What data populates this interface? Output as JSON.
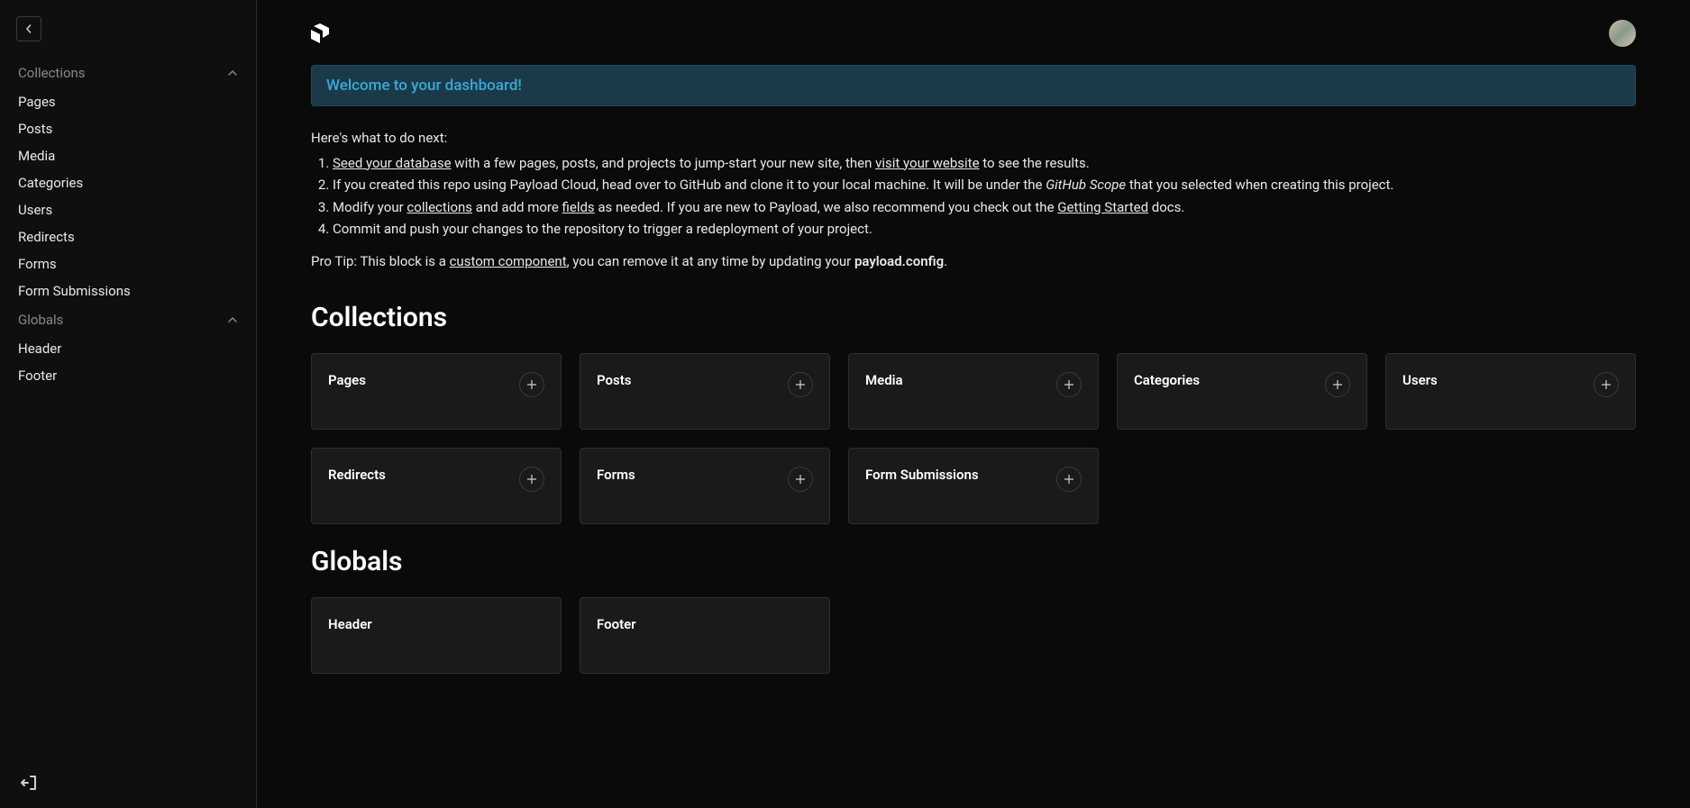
{
  "sidebar": {
    "groups": [
      {
        "label": "Collections",
        "items": [
          "Pages",
          "Posts",
          "Media",
          "Categories",
          "Users",
          "Redirects",
          "Forms",
          "Form Submissions"
        ]
      },
      {
        "label": "Globals",
        "items": [
          "Header",
          "Footer"
        ]
      }
    ]
  },
  "banner": "Welcome to your dashboard!",
  "intro": {
    "lead": "Here's what to do next:",
    "step1_link1": "Seed your database",
    "step1_mid": " with a few pages, posts, and projects to jump-start your new site, then ",
    "step1_link2": "visit your website",
    "step1_end": " to see the results.",
    "step2_a": "If you created this repo using Payload Cloud, head over to GitHub and clone it to your local machine. It will be under the ",
    "step2_em": "GitHub Scope",
    "step2_b": " that you selected when creating this project.",
    "step3_a": "Modify your ",
    "step3_link1": "collections",
    "step3_b": " and add more ",
    "step3_link2": "fields",
    "step3_c": " as needed. If you are new to Payload, we also recommend you check out the ",
    "step3_link3": "Getting Started",
    "step3_d": " docs.",
    "step4": "Commit and push your changes to the repository to trigger a redeployment of your project.",
    "protip_a": "Pro Tip: This block is a ",
    "protip_link": "custom component",
    "protip_b": ", you can remove it at any time by updating your ",
    "protip_strong": "payload.config",
    "protip_c": "."
  },
  "sections": {
    "collections": {
      "heading": "Collections",
      "cards": [
        "Pages",
        "Posts",
        "Media",
        "Categories",
        "Users",
        "Redirects",
        "Forms",
        "Form Submissions"
      ]
    },
    "globals": {
      "heading": "Globals",
      "cards": [
        "Header",
        "Footer"
      ]
    }
  }
}
